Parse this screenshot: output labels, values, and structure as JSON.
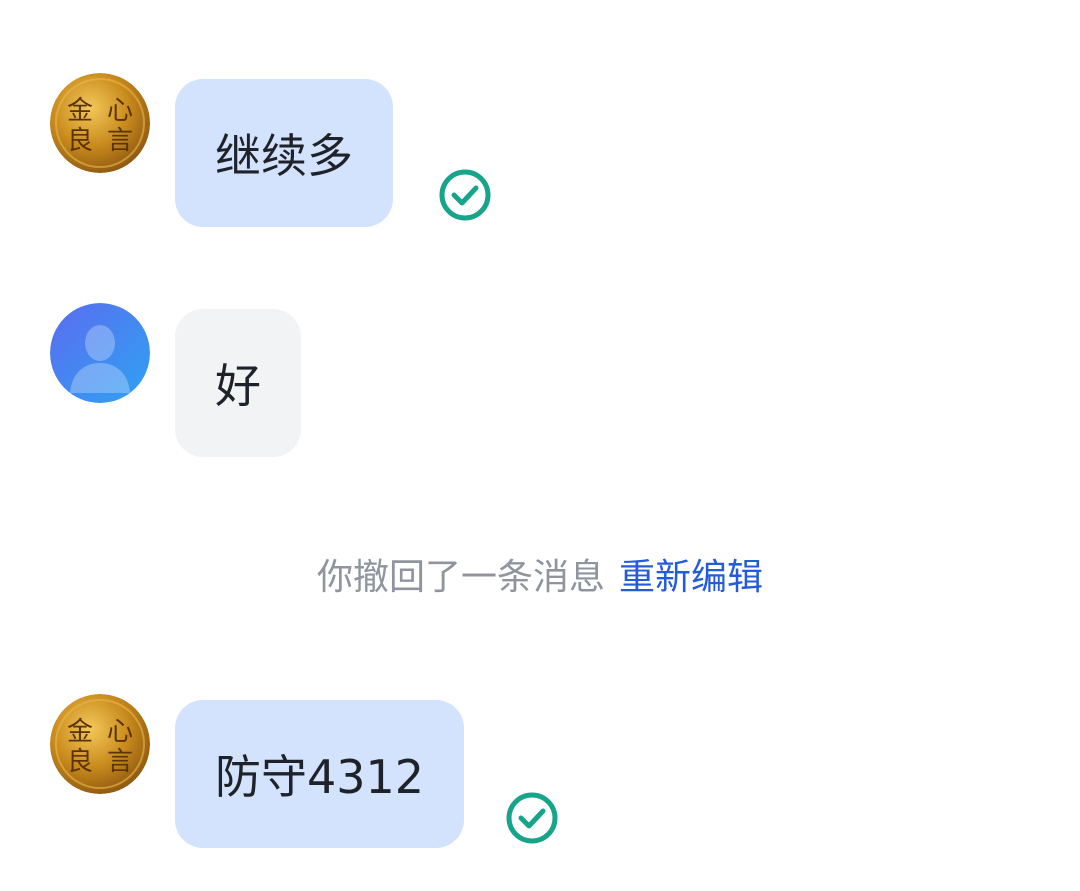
{
  "messages": [
    {
      "sender": "self",
      "text": "继续多",
      "status": "read",
      "avatar": {
        "icon": "golden-coin-avatar",
        "chars": [
          "金",
          "心",
          "良",
          "言"
        ]
      }
    },
    {
      "sender": "other",
      "text": "好",
      "avatar": {
        "icon": "default-person-avatar"
      }
    },
    {
      "sender": "self",
      "text": "防守4312",
      "status": "read",
      "avatar": {
        "icon": "golden-coin-avatar",
        "chars": [
          "金",
          "心",
          "良",
          "言"
        ]
      }
    }
  ],
  "system_notice": {
    "text": "你撤回了一条消息",
    "action_label": "重新编辑"
  },
  "colors": {
    "self_bubble": "#d3e3fd",
    "other_bubble": "#f2f3f5",
    "read_check": "#16a58a",
    "link": "#245bdb",
    "system_text": "#8f959e"
  }
}
